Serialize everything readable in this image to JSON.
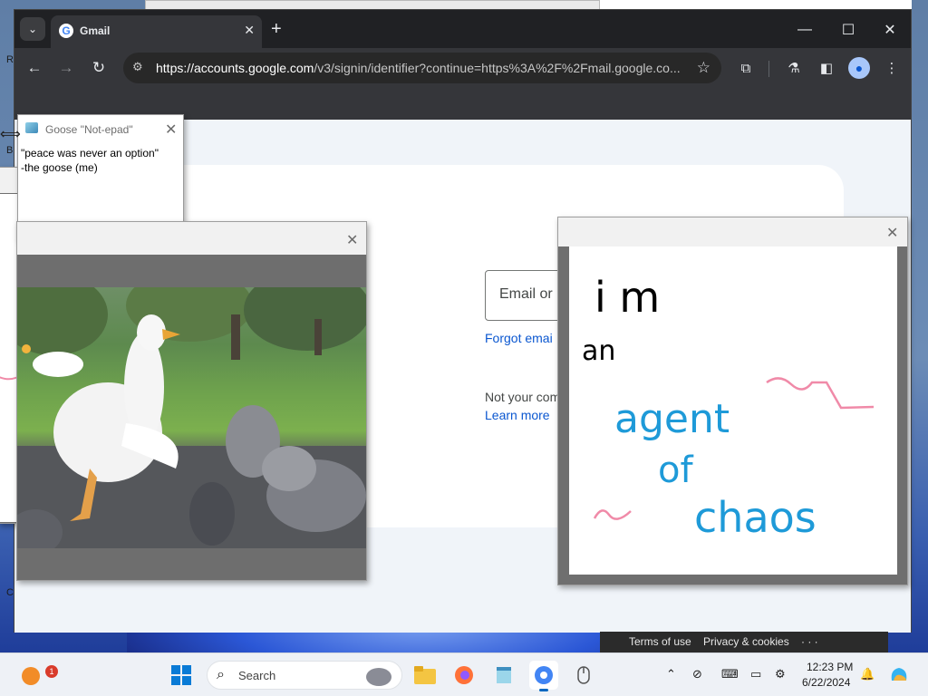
{
  "browser": {
    "tab": {
      "title": "Gmail",
      "favicon": "google-g-icon"
    },
    "url_host": "https://accounts.google.com",
    "url_path": "/v3/signin/identifier?continue=https%3A%2F%2Fmail.google.co...",
    "icons": [
      "tab-search-icon",
      "new-tab-icon",
      "minimize-icon",
      "maximize-icon",
      "close-icon",
      "back-icon",
      "forward-icon",
      "reload-icon",
      "site-info-icon",
      "star-icon",
      "extensions-icon",
      "labs-icon",
      "side-panel-icon",
      "profile-icon",
      "menu-icon"
    ]
  },
  "signin": {
    "email_placeholder": "Email or p",
    "forgot_email": "Forgot emai",
    "not_your_computer": "Not your com",
    "learn_more": "Learn more"
  },
  "footer": {
    "terms": "Terms of use",
    "privacy": "Privacy & cookies",
    "more": "· · ·"
  },
  "goose_note": {
    "title": "Goose \"Not-epad\"",
    "line1": "\"peace was never an option\"",
    "line2": "-the goose (me)"
  },
  "chaos_drawing": {
    "line1": "i m",
    "line2": "an",
    "line3": "agent",
    "line4": "of",
    "line5": "chaos",
    "colors": {
      "black_text": "#000000",
      "blue_text": "#1e9ad8",
      "pink_scribble": "#f08aa8"
    }
  },
  "taskbar": {
    "search_label": "Search",
    "notification_count": "1",
    "time": "12:23 PM",
    "date": "6/22/2024",
    "apps": [
      "start-icon",
      "search-icon",
      "file-explorer-icon",
      "firefox-icon",
      "notepad-icon",
      "chrome-icon",
      "mouse-icon"
    ],
    "tray": [
      "chevron-up-icon",
      "network-icon",
      "keyboard-icon",
      "display-icon",
      "accessibility-icon",
      "bell-icon",
      "copilot-icon"
    ]
  },
  "desktop": {
    "letters": [
      "R",
      "B",
      "C"
    ]
  }
}
